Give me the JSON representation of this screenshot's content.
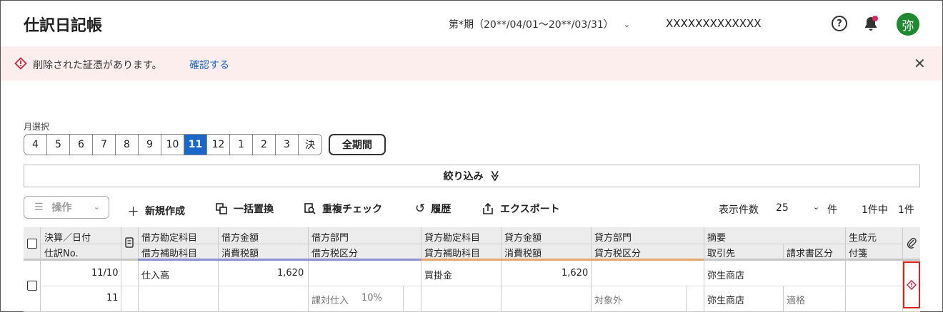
{
  "header": {
    "title": "仕訳日記帳",
    "period": "第*期（20**/04/01〜20**/03/31）",
    "company": "XXXXXXXXXXXXX",
    "help": "?",
    "avatar": "弥"
  },
  "alert": {
    "message": "削除された証憑があります。",
    "link": "確認する",
    "close": "✕"
  },
  "month_selector": {
    "label": "月選択",
    "months": [
      "4",
      "5",
      "6",
      "7",
      "8",
      "9",
      "10",
      "11",
      "12",
      "1",
      "2",
      "3",
      "決"
    ],
    "active": "11",
    "all_label": "全期間"
  },
  "filter": {
    "label": "絞り込み",
    "chevron": "≫"
  },
  "toolbar": {
    "ops_label": "操作",
    "new": "新規作成",
    "replace": "一括置換",
    "dup_check": "重複チェック",
    "history": "履歴",
    "export": "エクスポート",
    "page_size_label": "表示件数",
    "page_size": "25",
    "unit": "件",
    "count_text": "1件中　1件"
  },
  "table": {
    "headers": {
      "date": "決算／日付",
      "journal_no": "仕訳No.",
      "debit_account": "借方勘定科目",
      "debit_sub": "借方補助科目",
      "debit_amount": "借方金額",
      "debit_tax": "消費税額",
      "debit_dept": "借方部門",
      "debit_tax_cat": "借方税区分",
      "credit_account": "貸方勘定科目",
      "credit_sub": "貸方補助科目",
      "credit_amount": "貸方金額",
      "credit_tax": "消費税額",
      "credit_dept": "貸方部門",
      "credit_tax_cat": "貸方税区分",
      "summary": "摘要",
      "partner": "取引先",
      "invoice_cat": "請求書区分",
      "source": "生成元",
      "sticky": "付箋"
    },
    "colors": {
      "debit_accent": "#8b8fd6",
      "credit_accent": "#e7a66a",
      "summary_accent": "#c7c7c7"
    },
    "rows": [
      {
        "date": "11/10",
        "journal_no": "11",
        "debit_account": "仕入高",
        "debit_amount": "1,620",
        "debit_tax_cat": "課対仕入",
        "debit_tax_rate": "10%",
        "credit_account": "買掛金",
        "credit_amount": "1,620",
        "credit_tax_cat": "対象外",
        "summary": "弥生商店",
        "partner": "弥生商店",
        "invoice_cat": "適格"
      }
    ]
  }
}
